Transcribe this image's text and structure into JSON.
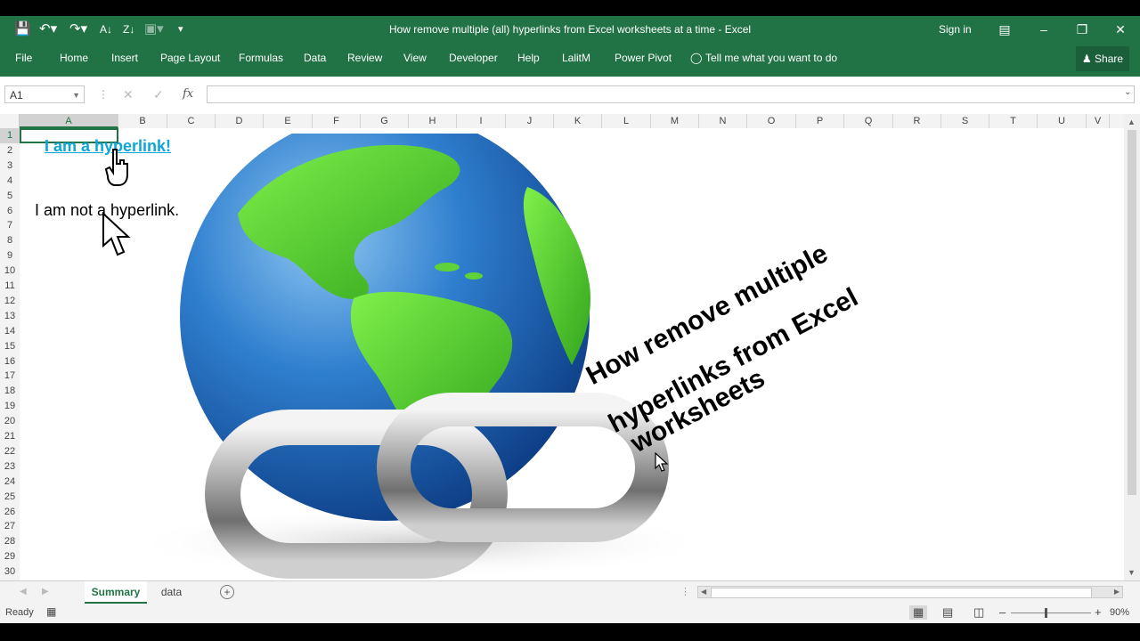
{
  "window": {
    "title": "How remove multiple (all) hyperlinks from Excel worksheets at a time  -  Excel",
    "sign_in": "Sign in",
    "share": "Share"
  },
  "ribbon": {
    "tabs": [
      "File",
      "Home",
      "Insert",
      "Page Layout",
      "Formulas",
      "Data",
      "Review",
      "View",
      "Developer",
      "Help",
      "LalitM",
      "Power Pivot"
    ],
    "tell_me": "Tell me what you want to do"
  },
  "formula_bar": {
    "name_box": "A1",
    "fx": "fx",
    "value": ""
  },
  "columns": [
    "A",
    "B",
    "C",
    "D",
    "E",
    "F",
    "G",
    "H",
    "I",
    "J",
    "K",
    "L",
    "M",
    "N",
    "O",
    "P",
    "Q",
    "R",
    "S",
    "T",
    "U",
    "V"
  ],
  "rows": [
    "1",
    "2",
    "3",
    "4",
    "5",
    "6",
    "7",
    "8",
    "9",
    "10",
    "11",
    "12",
    "13",
    "14",
    "15",
    "16",
    "17",
    "18",
    "19",
    "20",
    "21",
    "22",
    "23",
    "24",
    "25",
    "26",
    "27",
    "28",
    "29",
    "30"
  ],
  "cells": {
    "hyperlink": "I am a hyperlink!",
    "plain": "I am not a hyperlink.",
    "overlay_lines": [
      "How remove multiple",
      "hyperlinks from Excel",
      "worksheets"
    ]
  },
  "sheet_tabs": {
    "active": "Summary",
    "other": "data"
  },
  "status": {
    "ready": "Ready",
    "zoom": "90%"
  },
  "colors": {
    "excel_green": "#217346",
    "link_blue": "#0ea5d9"
  }
}
